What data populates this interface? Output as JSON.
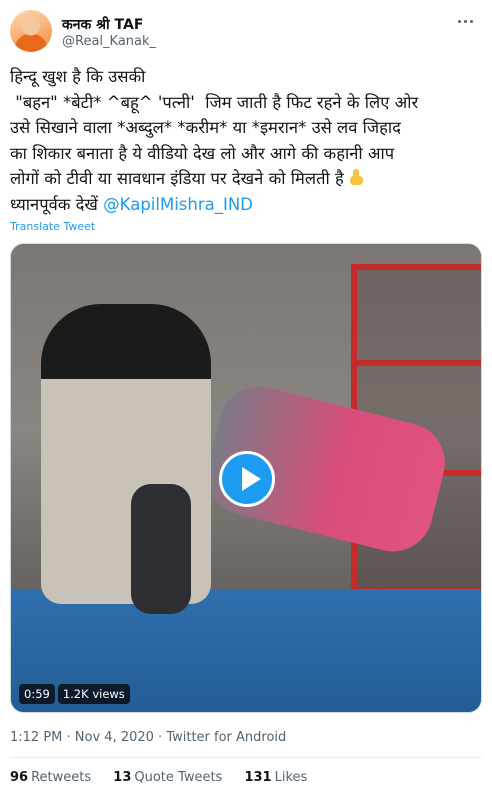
{
  "author": {
    "display_name": "कनक श्री TAF",
    "handle": "@Real_Kanak_"
  },
  "tweet": {
    "lines": [
      "हिन्दू खुश है कि उसकी",
      " \"बहन\" *बेटी* ^बहू^ 'पत्नी'  जिम जाती है फिट रहने के लिए ओर",
      "उसे सिखाने वाला *अब्दुल* *करीम* या *इमरान* उसे लव जिहाद",
      "का शिकार बनाता है ये वीडियो देख लो और आगे की कहानी आप",
      "लोगों को टीवी या सावधान इंडिया पर देखने को मिलती है"
    ],
    "last_line_prefix": "ध्यानपूर्वक देखें ",
    "mention": "@KapilMishra_IND",
    "emoji_icon": "backhand-index-pointing-down"
  },
  "translate_label": "Translate Tweet",
  "video": {
    "duration": "0:59",
    "views": "1.2K views",
    "play_icon": "play-icon"
  },
  "meta": {
    "time": "1:12 PM",
    "separator": " · ",
    "date": "Nov 4, 2020",
    "source": "Twitter for Android"
  },
  "stats": {
    "retweets_count": "96",
    "retweets_label": "Retweets",
    "quotes_count": "13",
    "quotes_label": "Quote Tweets",
    "likes_count": "131",
    "likes_label": "Likes"
  },
  "colors": {
    "accent": "#1d9bf0",
    "text": "#0f1419",
    "secondary": "#536471"
  }
}
